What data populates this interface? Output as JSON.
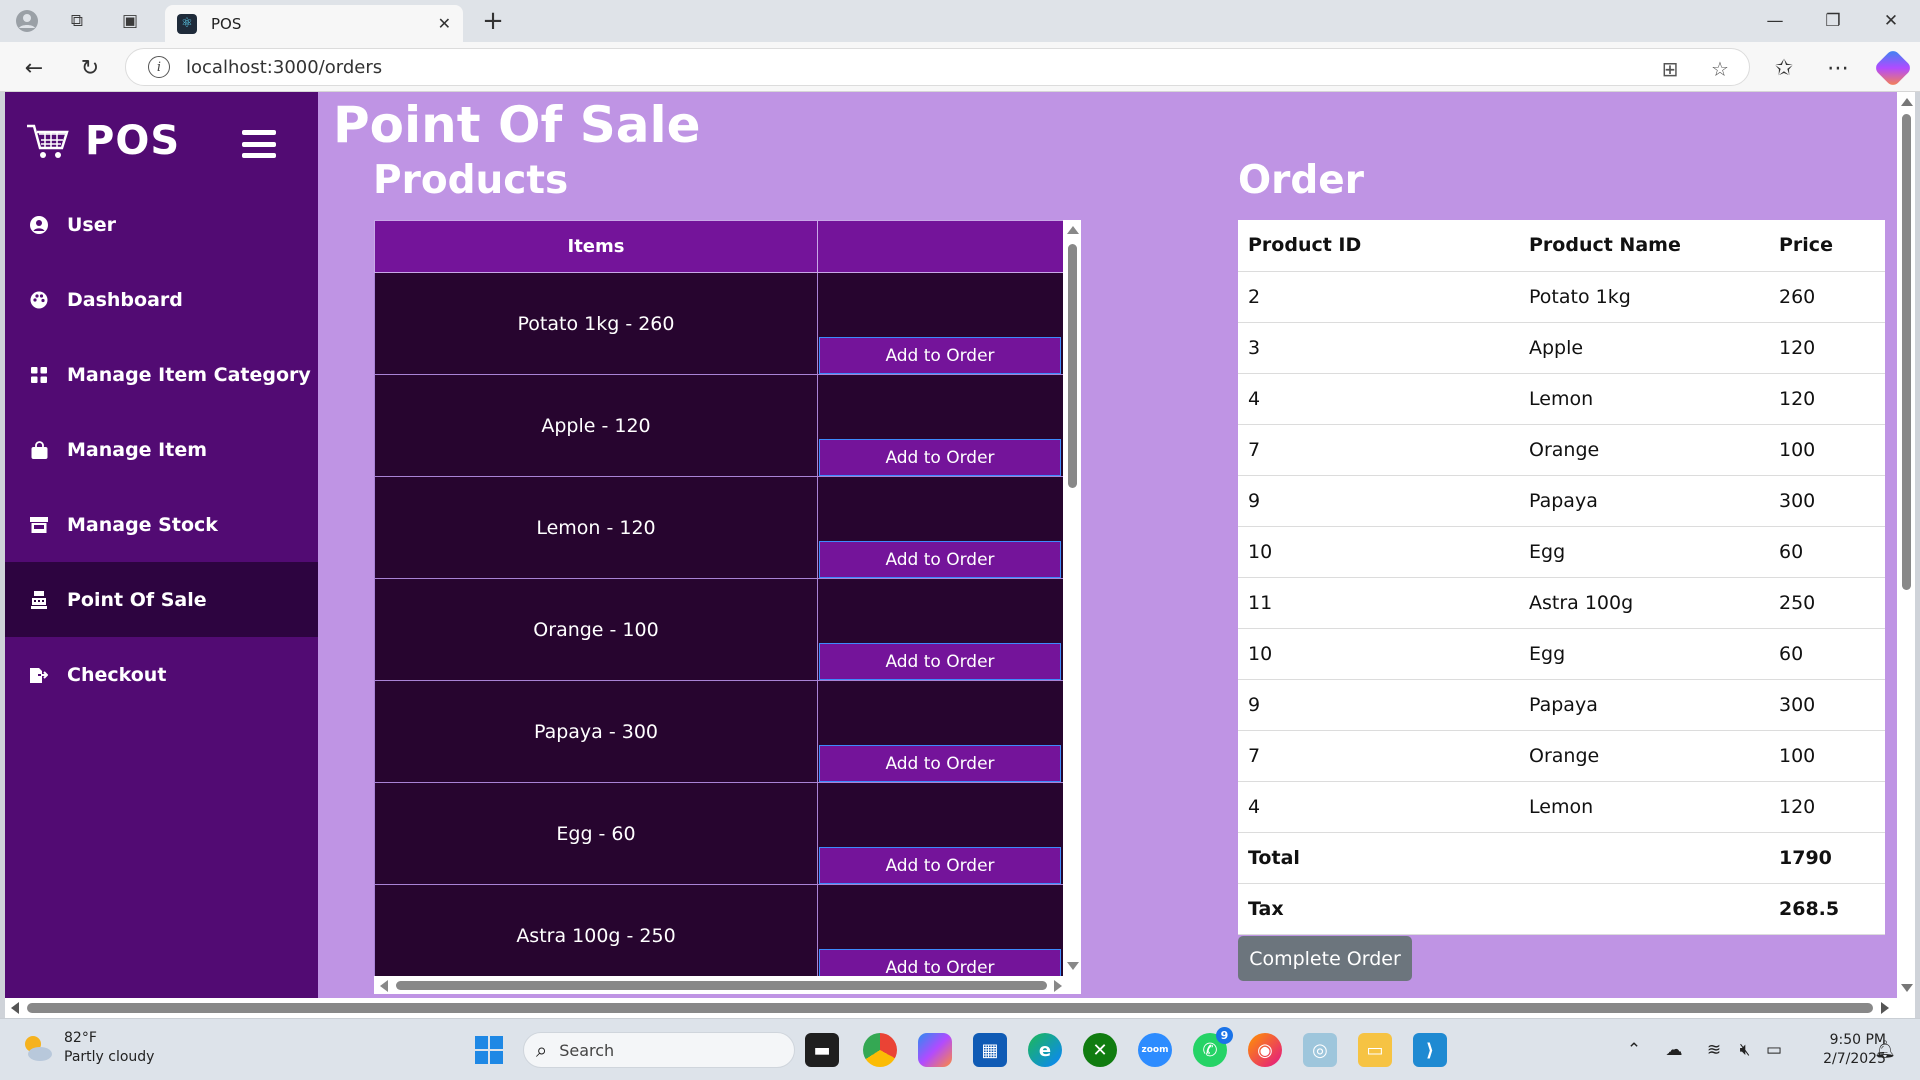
{
  "browser": {
    "tab_title": "POS",
    "tab_favicon": "react-icon",
    "url": "localhost:3000/orders"
  },
  "sidebar": {
    "brand": "POS",
    "items": [
      {
        "label": "User",
        "icon": "user-circle-icon"
      },
      {
        "label": "Dashboard",
        "icon": "palette-icon"
      },
      {
        "label": "Manage Item Category",
        "icon": "grid-icon"
      },
      {
        "label": "Manage Item",
        "icon": "shopping-bag-icon"
      },
      {
        "label": "Manage Stock",
        "icon": "store-icon"
      },
      {
        "label": "Point Of Sale",
        "icon": "cash-register-icon",
        "active": true
      },
      {
        "label": "Checkout",
        "icon": "file-export-icon"
      }
    ]
  },
  "page": {
    "title": "Point Of Sale",
    "products_title": "Products",
    "order_title": "Order"
  },
  "products": {
    "header_items": "Items",
    "header_action": "",
    "add_label": "Add to Order",
    "rows": [
      "Potato 1kg - 260",
      "Apple - 120",
      "Lemon - 120",
      "Orange - 100",
      "Papaya - 300",
      "Egg - 60",
      "Astra 100g - 250"
    ]
  },
  "order": {
    "headers": {
      "id": "Product ID",
      "name": "Product Name",
      "price": "Price"
    },
    "rows": [
      {
        "id": "2",
        "name": "Potato 1kg",
        "price": "260"
      },
      {
        "id": "3",
        "name": "Apple",
        "price": "120"
      },
      {
        "id": "4",
        "name": "Lemon",
        "price": "120"
      },
      {
        "id": "7",
        "name": "Orange",
        "price": "100"
      },
      {
        "id": "9",
        "name": "Papaya",
        "price": "300"
      },
      {
        "id": "10",
        "name": "Egg",
        "price": "60"
      },
      {
        "id": "11",
        "name": "Astra 100g",
        "price": "250"
      },
      {
        "id": "10",
        "name": "Egg",
        "price": "60"
      },
      {
        "id": "9",
        "name": "Papaya",
        "price": "300"
      },
      {
        "id": "7",
        "name": "Orange",
        "price": "100"
      },
      {
        "id": "4",
        "name": "Lemon",
        "price": "120"
      }
    ],
    "total_label": "Total",
    "total_value": "1790",
    "tax_label": "Tax",
    "tax_value": "268.5",
    "complete_label": "Complete Order"
  },
  "taskbar": {
    "weather_temp": "82°F",
    "weather_desc": "Partly cloudy",
    "search_placeholder": "Search",
    "whatsapp_badge": "9",
    "time": "9:50 PM",
    "date": "2/7/2025"
  },
  "colors": {
    "sidebar": "#520b73",
    "sidebar_active": "#2d0440",
    "page_bg": "#bf94e4",
    "table_header": "#74149a",
    "table_cell": "#27052f",
    "complete_button": "#6c757d"
  }
}
